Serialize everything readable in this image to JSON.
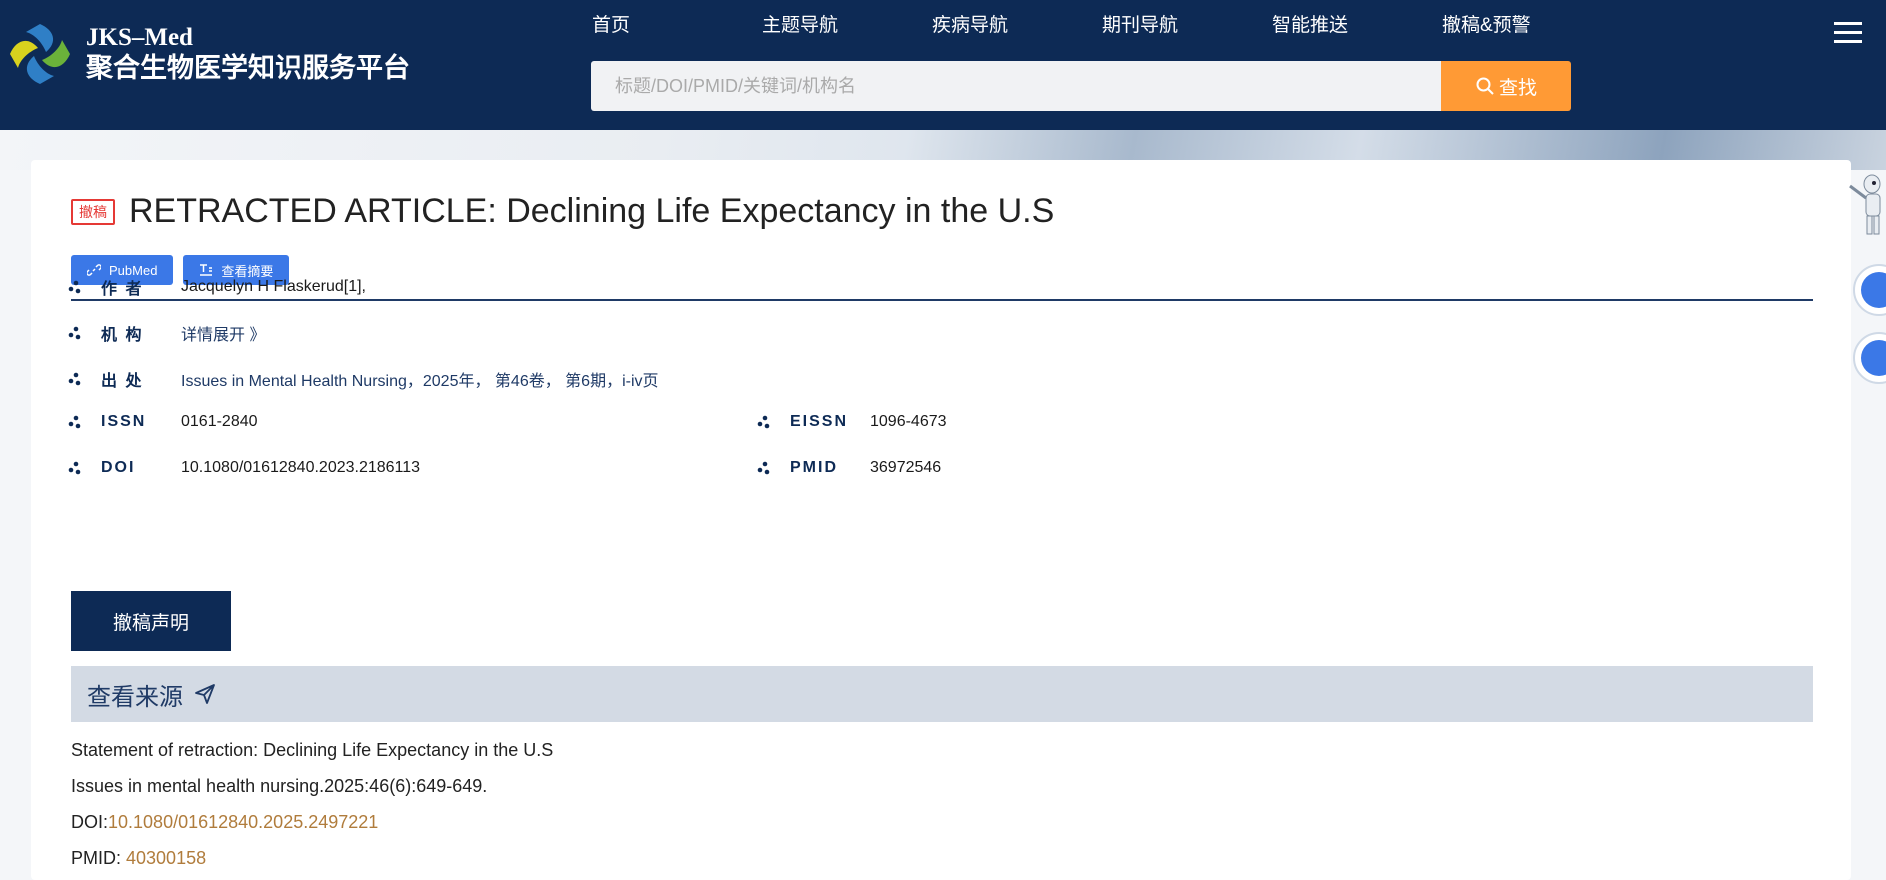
{
  "header": {
    "logo_line1": "JKS–Med",
    "logo_line2": "聚合生物医学知识服务平台",
    "nav": [
      "首页",
      "主题导航",
      "疾病导航",
      "期刊导航",
      "智能推送",
      "撤稿&预警"
    ],
    "search_placeholder": "标题/DOI/PMID/关键词/机构名",
    "search_button": "查找",
    "menu_icon": "hamburger-menu-icon"
  },
  "article": {
    "badge": "撤稿",
    "title": "RETRACTED ARTICLE: Declining Life Expectancy in the U.S",
    "buttons": {
      "pubmed": "PubMed",
      "abstract": "查看摘要"
    },
    "fields": {
      "author_label": "作 者",
      "author_value": "Jacquelyn H Flaskerud[1],",
      "institution_label": "机 构",
      "institution_value": "详情展开 》",
      "source_label": "出 处",
      "source_value": "Issues in Mental Health Nursing，2025年， 第46卷， 第6期，i-iv页",
      "issn_label": "ISSN",
      "issn_value": "0161-2840",
      "eissn_label": "EISSN",
      "eissn_value": "1096-4673",
      "doi_label": "DOI",
      "doi_value": "10.1080/01612840.2023.2186113",
      "pmid_label": "PMID",
      "pmid_value": "36972546"
    },
    "retraction_button": "撤稿声明",
    "source_section": {
      "title": "查看来源",
      "statement": "Statement of retraction: Declining Life Expectancy in the U.S",
      "citation": "Issues in mental health nursing.2025:46(6):649-649.",
      "doi_prefix": "DOI:",
      "doi_link": "10.1080/01612840.2025.2497221",
      "pmid_prefix": "PMID: ",
      "pmid_link": "40300158"
    }
  },
  "colors": {
    "header_bg": "#0d2a55",
    "search_btn": "#ff9a35",
    "accent_blue": "#3b78e7",
    "badge_red": "#e53935",
    "link_gold": "#b07c3c"
  }
}
